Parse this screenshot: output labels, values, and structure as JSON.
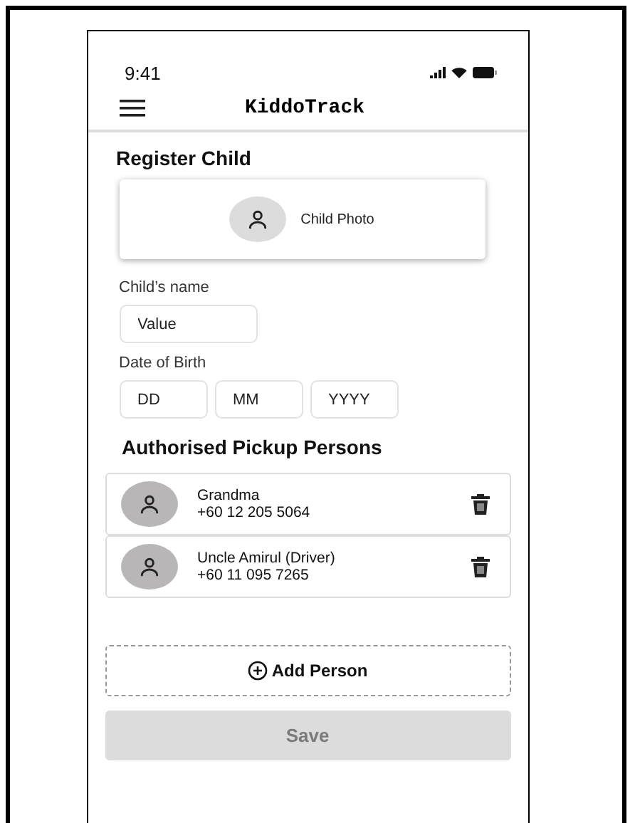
{
  "status_bar": {
    "time": "9:41"
  },
  "app_bar": {
    "title": "KiddoTrack"
  },
  "section_title": "Register Child",
  "child_photo": {
    "label": "Child Photo"
  },
  "fields": [
    {
      "label": "Child’s name",
      "inputs": [
        {
          "value": "Value"
        }
      ]
    },
    {
      "label": "Date of Birth",
      "inputs": [
        {
          "placeholder": "DD"
        },
        {
          "placeholder": "MM"
        },
        {
          "placeholder": "YYYY"
        }
      ]
    }
  ],
  "pickup_title": "Authorised Pickup Persons",
  "pickup_persons": [
    {
      "name": "Grandma",
      "phone": "+60 12 205 5064"
    },
    {
      "name": "Uncle Amirul (Driver)",
      "phone": "+60 11 095 7265"
    }
  ],
  "add_button": {
    "label": "Add Person"
  },
  "save_button": {
    "label": "Save",
    "disabled": true
  }
}
